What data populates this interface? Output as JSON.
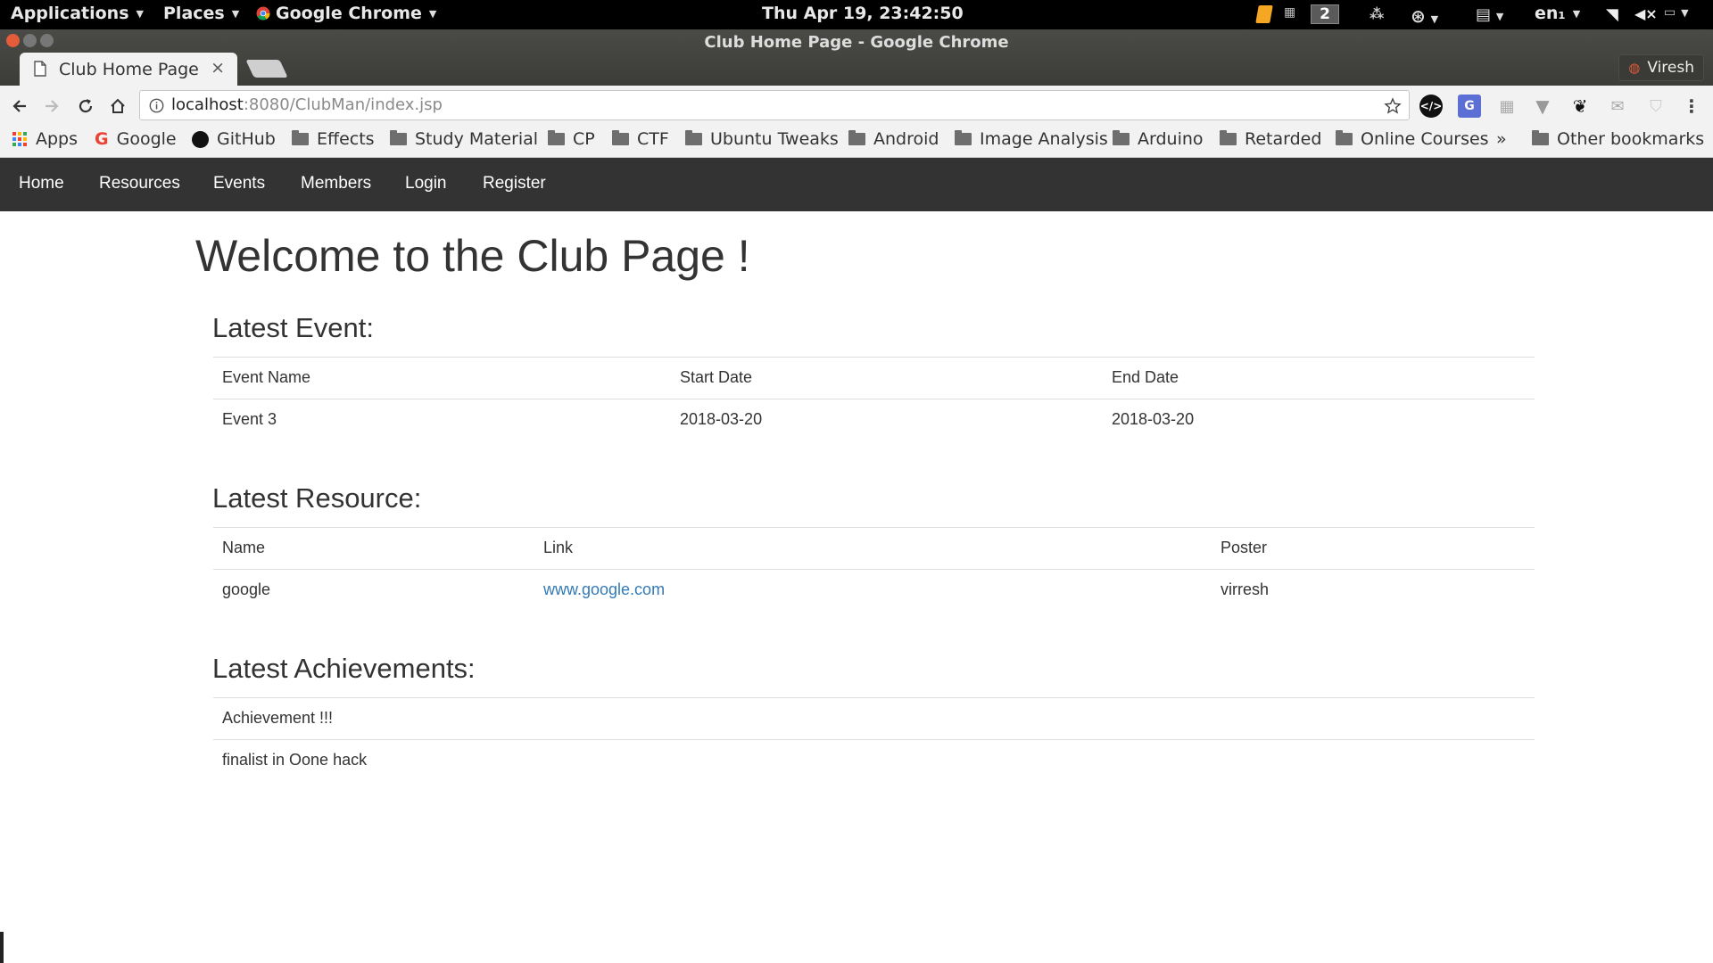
{
  "panel": {
    "applications": "Applications",
    "places": "Places",
    "browser": "Google Chrome",
    "clock": "Thu Apr 19, 23:42:50",
    "workspace": "2",
    "language": "en₁"
  },
  "window": {
    "title": "Club Home Page - Google Chrome",
    "tab_title": "Club Home Page",
    "profile": "Viresh"
  },
  "toolbar": {
    "url_host": "localhost",
    "url_path": ":8080/ClubMan/index.jsp"
  },
  "bookmarks": [
    "Apps",
    "Google",
    "GitHub",
    "Effects",
    "Study Material",
    "CP",
    "CTF",
    "Ubuntu Tweaks",
    "Android",
    "Image Analysis",
    "Arduino",
    "Retarded",
    "Online Courses",
    "»",
    "Other bookmarks"
  ],
  "nav": [
    "Home",
    "Resources",
    "Events",
    "Members",
    "Login",
    "Register"
  ],
  "page": {
    "title": "Welcome to the Club Page !",
    "event": {
      "heading": "Latest Event:",
      "columns": [
        "Event Name",
        "Start Date",
        "End Date"
      ],
      "rows": [
        [
          "Event 3",
          "2018-03-20",
          "2018-03-20"
        ]
      ]
    },
    "resource": {
      "heading": "Latest Resource:",
      "columns": [
        "Name",
        "Link",
        "Poster"
      ],
      "rows": [
        [
          "google",
          "www.google.com",
          "virresh"
        ]
      ]
    },
    "achievements": {
      "heading": "Latest Achievements:",
      "items": [
        "Achievement !!!",
        "finalist in Oone hack"
      ]
    }
  },
  "colors": {
    "navbar": "#333333",
    "link": "#337ab7",
    "panel": "#000000"
  }
}
